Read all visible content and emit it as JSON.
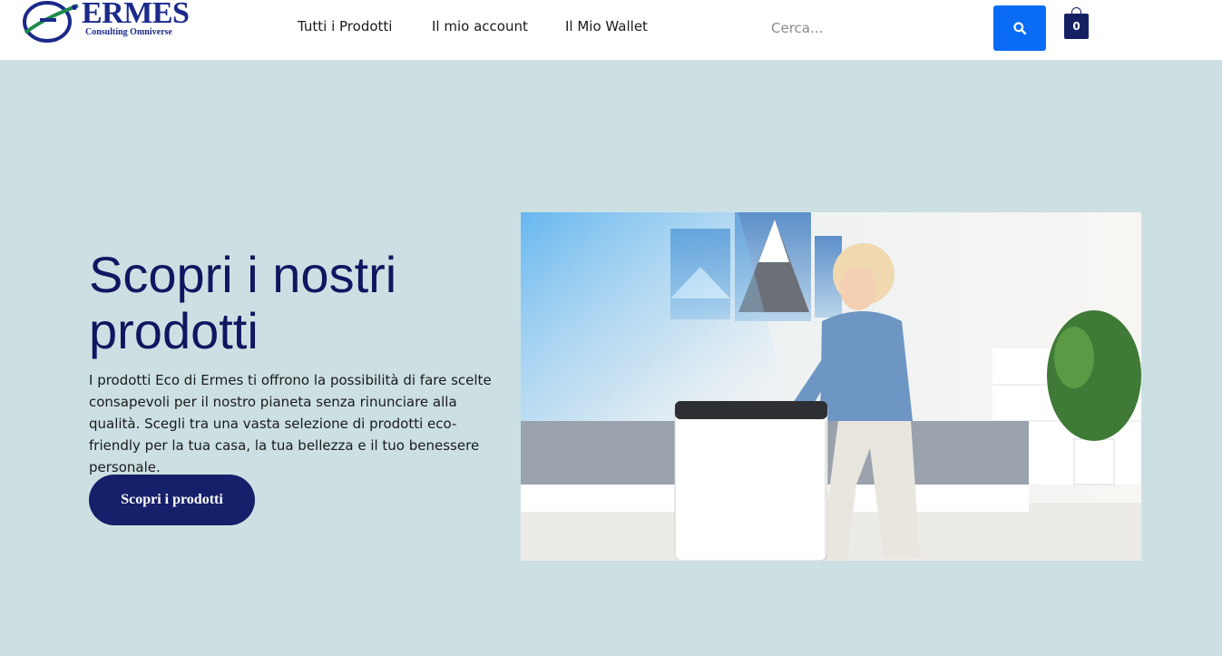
{
  "brand": {
    "name": "ERMES",
    "tagline": "Consulting Omniverse",
    "colors": {
      "primary": "#16206a",
      "accent": "#0a6cf5",
      "hero_bg": "#cce0e3"
    }
  },
  "nav": {
    "items": [
      {
        "label": "Tutti i Prodotti"
      },
      {
        "label": "Il mio account"
      },
      {
        "label": "Il Mio Wallet"
      }
    ]
  },
  "search": {
    "placeholder": "Cerca...",
    "icon": "search-icon"
  },
  "cart": {
    "count": "0",
    "icon": "shopping-bag-icon"
  },
  "hero": {
    "title": "Scopri i nostri prodotti",
    "description": "I prodotti Eco di Ermes ti offrono la possibilità di fare scelte consapevoli per il nostro pianeta senza rinunciare alla qualità. Scegli tra una vasta selezione di prodotti eco-friendly per la tua casa, la tua bellezza e il tuo benessere personale.",
    "button_label": "Scopri i prodotti"
  }
}
